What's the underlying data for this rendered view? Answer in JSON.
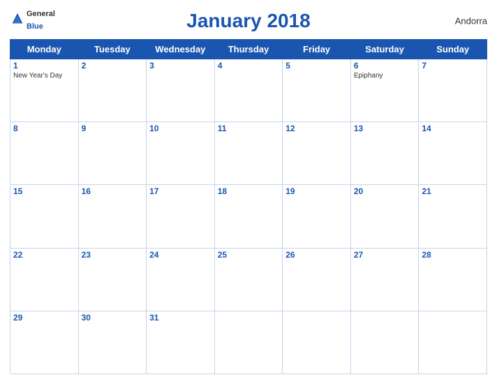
{
  "header": {
    "logo_general": "General",
    "logo_blue": "Blue",
    "title": "January 2018",
    "country": "Andorra"
  },
  "weekdays": [
    "Monday",
    "Tuesday",
    "Wednesday",
    "Thursday",
    "Friday",
    "Saturday",
    "Sunday"
  ],
  "weeks": [
    [
      {
        "day": "1",
        "holiday": "New Year's Day"
      },
      {
        "day": "2",
        "holiday": ""
      },
      {
        "day": "3",
        "holiday": ""
      },
      {
        "day": "4",
        "holiday": ""
      },
      {
        "day": "5",
        "holiday": ""
      },
      {
        "day": "6",
        "holiday": "Epiphany"
      },
      {
        "day": "7",
        "holiday": ""
      }
    ],
    [
      {
        "day": "8",
        "holiday": ""
      },
      {
        "day": "9",
        "holiday": ""
      },
      {
        "day": "10",
        "holiday": ""
      },
      {
        "day": "11",
        "holiday": ""
      },
      {
        "day": "12",
        "holiday": ""
      },
      {
        "day": "13",
        "holiday": ""
      },
      {
        "day": "14",
        "holiday": ""
      }
    ],
    [
      {
        "day": "15",
        "holiday": ""
      },
      {
        "day": "16",
        "holiday": ""
      },
      {
        "day": "17",
        "holiday": ""
      },
      {
        "day": "18",
        "holiday": ""
      },
      {
        "day": "19",
        "holiday": ""
      },
      {
        "day": "20",
        "holiday": ""
      },
      {
        "day": "21",
        "holiday": ""
      }
    ],
    [
      {
        "day": "22",
        "holiday": ""
      },
      {
        "day": "23",
        "holiday": ""
      },
      {
        "day": "24",
        "holiday": ""
      },
      {
        "day": "25",
        "holiday": ""
      },
      {
        "day": "26",
        "holiday": ""
      },
      {
        "day": "27",
        "holiday": ""
      },
      {
        "day": "28",
        "holiday": ""
      }
    ],
    [
      {
        "day": "29",
        "holiday": ""
      },
      {
        "day": "30",
        "holiday": ""
      },
      {
        "day": "31",
        "holiday": ""
      },
      {
        "day": "",
        "holiday": ""
      },
      {
        "day": "",
        "holiday": ""
      },
      {
        "day": "",
        "holiday": ""
      },
      {
        "day": "",
        "holiday": ""
      }
    ]
  ]
}
